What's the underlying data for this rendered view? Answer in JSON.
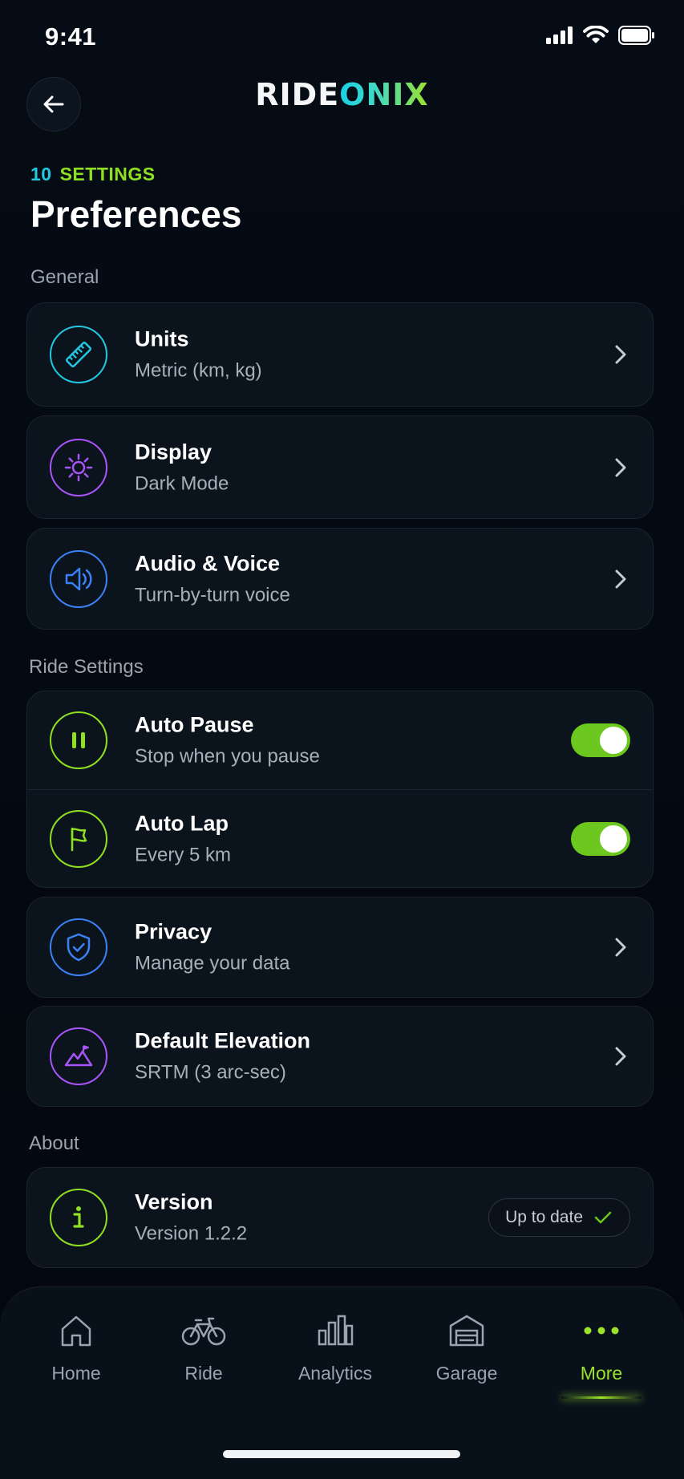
{
  "status_bar": {
    "time": "9:41"
  },
  "header": {
    "logo_part1": "RIDE",
    "logo_part2": "ONIX"
  },
  "summary": {
    "count": "10",
    "count_label": "SETTINGS",
    "title": "Preferences"
  },
  "sections": {
    "general": "General",
    "ride": "Ride Settings",
    "about": "About"
  },
  "general_items": [
    {
      "title": "Units",
      "subtitle": "Metric (km, kg)",
      "icon": "ruler-icon",
      "color": "#22c8e0"
    },
    {
      "title": "Display",
      "subtitle": "Dark Mode",
      "icon": "sun-icon",
      "color": "#a855f7"
    },
    {
      "title": "Audio & Voice",
      "subtitle": "Turn-by-turn voice",
      "icon": "speaker-icon",
      "color": "#3b82f6"
    }
  ],
  "ride_items": [
    {
      "title": "Auto Pause",
      "subtitle": "Stop when you pause",
      "icon": "pause-icon",
      "color": "#8fe021",
      "toggle": true
    },
    {
      "title": "Auto Lap",
      "subtitle": "Every 5 km",
      "icon": "flag-icon",
      "color": "#8fe021",
      "toggle": true
    },
    {
      "title": "Privacy",
      "subtitle": "Manage your data",
      "icon": "shield-icon",
      "color": "#3b82f6"
    },
    {
      "title": "Default Elevation",
      "subtitle": "SRTM (3 arc-sec)",
      "icon": "mountain-icon",
      "color": "#a855f7"
    }
  ],
  "about_items": [
    {
      "title": "Version",
      "subtitle": "Version 1.2.2",
      "icon": "info-icon",
      "color": "#8fe021",
      "badge": "Up to date"
    }
  ],
  "nav": [
    {
      "label": "Home",
      "icon": "home-icon"
    },
    {
      "label": "Ride",
      "icon": "bike-icon"
    },
    {
      "label": "Analytics",
      "icon": "bar-chart-icon"
    },
    {
      "label": "Garage",
      "icon": "garage-icon"
    },
    {
      "label": "More",
      "icon": "more-dots-icon",
      "active": true
    }
  ],
  "colors": {
    "accent_green": "#8fe021",
    "accent_cyan": "#22c8e0",
    "toggle_on": "#6cc81e",
    "background": "#040a12"
  }
}
